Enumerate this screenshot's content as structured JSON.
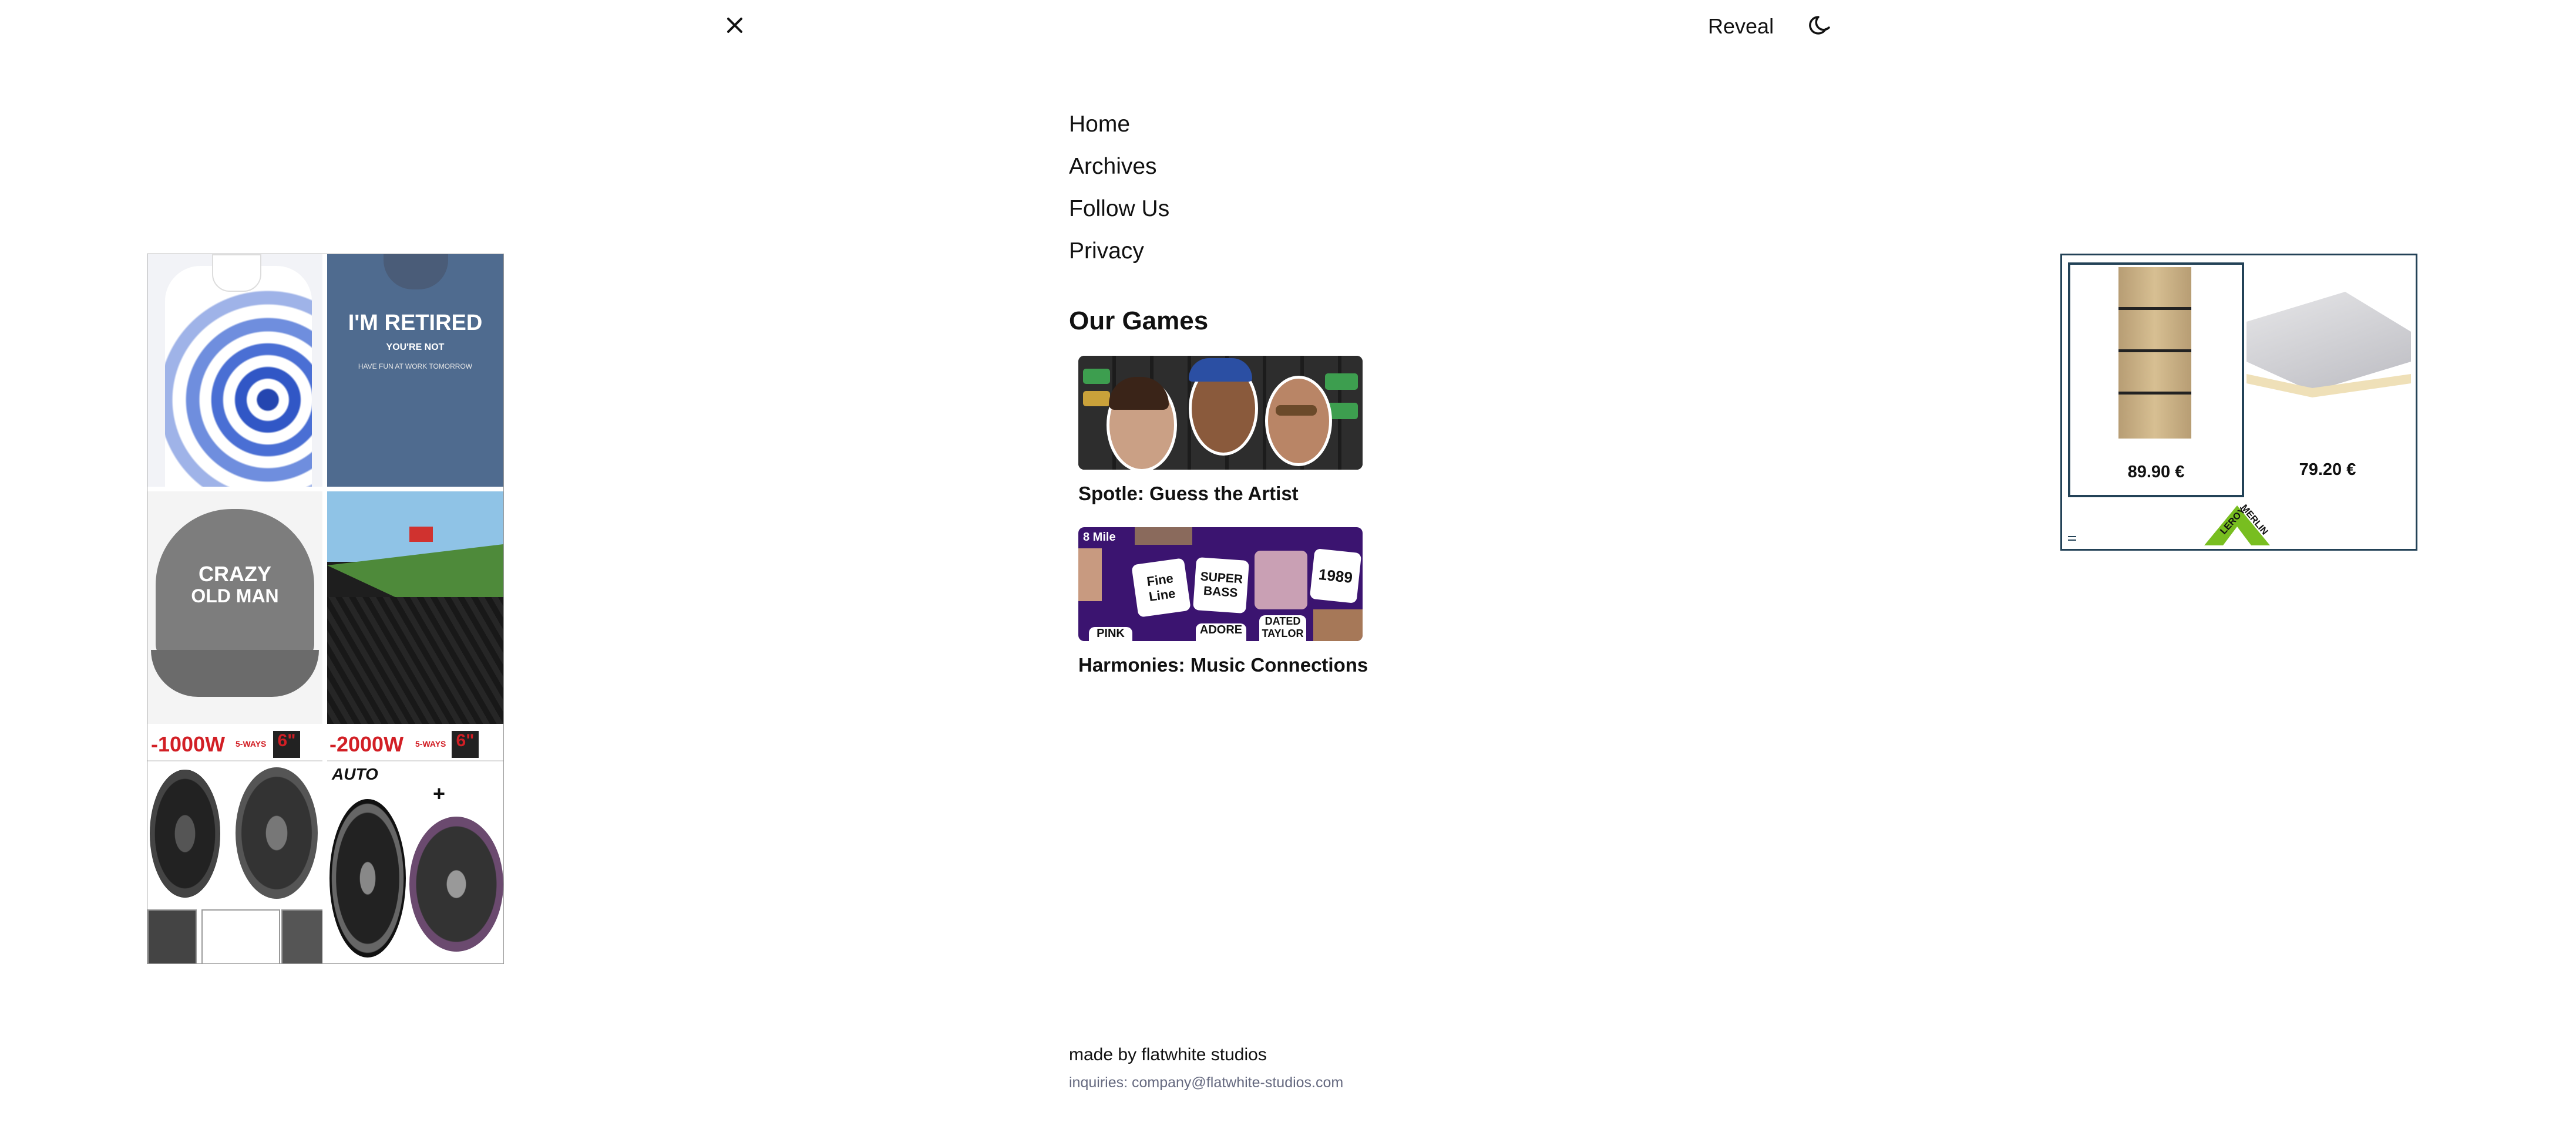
{
  "header": {
    "close_icon": "close-icon",
    "reveal_label": "Reveal",
    "theme_icon": "moon-icon"
  },
  "menu": {
    "items": [
      {
        "label": "Home"
      },
      {
        "label": "Archives"
      },
      {
        "label": "Follow Us"
      },
      {
        "label": "Privacy"
      }
    ]
  },
  "games": {
    "title": "Our Games",
    "items": [
      {
        "label": "Spotle: Guess the Artist"
      },
      {
        "label": "Harmonies: Music Connections"
      }
    ]
  },
  "footer": {
    "made_by": "made by flatwhite studios",
    "inquiries": "inquiries: company@flatwhite-studios.com"
  },
  "left_ad": {
    "shirt_text": "I'M RETIRED",
    "shirt_sub": "YOU'RE NOT",
    "shirt_line": "HAVE FUN AT WORK TOMORROW",
    "cap_text_1": "CRAZY",
    "cap_text_2": "OLD MAN",
    "speaker_1": "-1000W",
    "speaker_2": "-2000W",
    "ways": "5-WAYS",
    "size": "6\"",
    "auto": "AUTO"
  },
  "right_ad": {
    "products": [
      {
        "price": "89.90 €"
      },
      {
        "price": "79.20 €"
      }
    ],
    "brand": "LEROY MERLIN",
    "accent": "#234257",
    "brand_green": "#78be20"
  },
  "harmonies_tiles": [
    "8 Mile",
    "Fine Line",
    "SUPER BASS",
    "1989",
    "DATED TAYLOR",
    "ADORE",
    "PINK"
  ]
}
